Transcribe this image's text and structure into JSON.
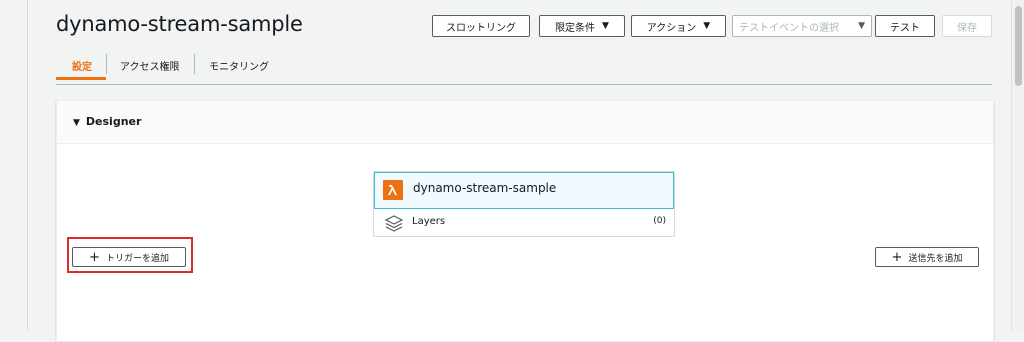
{
  "page": {
    "title": "dynamo-stream-sample"
  },
  "toolbar": {
    "throttle_label": "スロットリング",
    "qualifier_label": "限定条件",
    "actions_label": "アクション",
    "test_event_placeholder": "テストイベントの選択",
    "test_label": "テスト",
    "save_label": "保存"
  },
  "tabs": [
    {
      "label": "設定",
      "active": true
    },
    {
      "label": "アクセス権限",
      "active": false
    },
    {
      "label": "モニタリング",
      "active": false
    }
  ],
  "designer": {
    "title": "Designer",
    "function_name": "dynamo-stream-sample",
    "layers_label": "Layers",
    "layers_count": "(0)",
    "add_trigger_label": "トリガーを追加",
    "add_destination_label": "送信先を追加"
  },
  "colors": {
    "accent": "#ec7211",
    "highlight": "#e02b2b",
    "selection": "#44b9d6"
  },
  "icons": [
    "lambda-icon",
    "layers-icon",
    "plus-icon",
    "caret-down-icon",
    "triangle-down-icon"
  ]
}
